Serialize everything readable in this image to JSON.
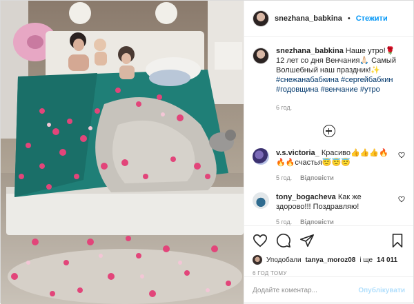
{
  "photo": {
    "alt_name": "post-photo"
  },
  "header": {
    "username": "snezhana_babkina",
    "separator": "•",
    "follow_label": "Стежити"
  },
  "caption": {
    "username": "snezhana_babkina",
    "text": "Наше утро!🌹 12 лет со дня Венчания🙏🏻 Самый Волшебный наш праздник!✨",
    "tags": "#снежанабабкина #сергейбабкин #годовщина #венчание #утро",
    "time": "6 год."
  },
  "comments": [
    {
      "username": "v.s.victoria_",
      "text": "Красиво👍👍👍🔥🔥🔥счастья😇😇😇",
      "time": "5 год.",
      "reply": "Відповісти"
    },
    {
      "username": "tony_bogacheva",
      "text": "Как же здорово!!! Поздравляю!",
      "time": "5 год.",
      "reply": "Відповісти"
    }
  ],
  "likes": {
    "prefix": "Уподобали",
    "user": "tanya_moroz08",
    "middle": "і ще",
    "count": "14 011"
  },
  "date_label": "6 год тому",
  "add_comment": {
    "placeholder": "Додайте коментар...",
    "publish_label": "Опублікувати"
  },
  "colors": {
    "follow_blue": "#0095f6",
    "publish_disabled": "#b2dffc",
    "teal_sheets": "#1f7f77",
    "rose_petal": "#e2457a"
  }
}
